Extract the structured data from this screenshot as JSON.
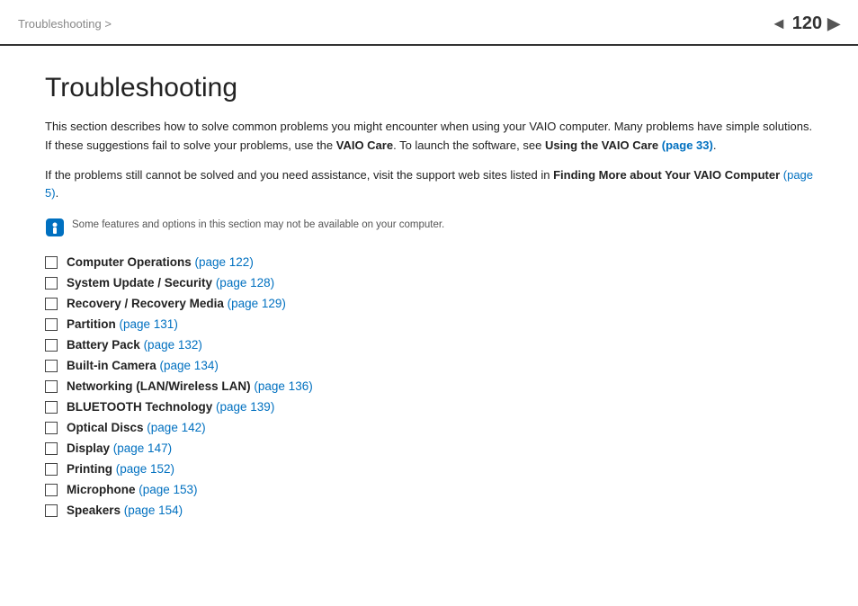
{
  "topbar": {
    "breadcrumb": "Troubleshooting >",
    "page_number": "120",
    "arrow": "◄"
  },
  "page": {
    "title": "Troubleshooting",
    "intro1": "This section describes how to solve common problems you might encounter when using your VAIO computer. Many problems have simple solutions. If these suggestions fail to solve your problems, use the ",
    "intro1_bold1": "VAIO Care",
    "intro1_mid": ". To launch the software, see ",
    "intro1_bold2": "Using the VAIO Care",
    "intro1_link1": "(page 33)",
    "intro1_end": ".",
    "intro2_start": "If the problems still cannot be solved and you need assistance, visit the support web sites listed in ",
    "intro2_bold": "Finding More about Your VAIO Computer",
    "intro2_link": "(page 5)",
    "intro2_end": ".",
    "note_text": "Some features and options in this section may not be available on your computer.",
    "topics": [
      {
        "label": "Computer Operations",
        "link": "(page 122)"
      },
      {
        "label": "System Update / Security",
        "link": "(page 128)"
      },
      {
        "label": "Recovery / Recovery Media",
        "link": "(page 129)"
      },
      {
        "label": "Partition",
        "link": "(page 131)"
      },
      {
        "label": "Battery Pack",
        "link": "(page 132)"
      },
      {
        "label": "Built-in Camera",
        "link": "(page 134)"
      },
      {
        "label": "Networking (LAN/Wireless LAN)",
        "link": "(page 136)"
      },
      {
        "label": "BLUETOOTH Technology",
        "link": "(page 139)"
      },
      {
        "label": "Optical Discs",
        "link": "(page 142)"
      },
      {
        "label": "Display",
        "link": "(page 147)"
      },
      {
        "label": "Printing",
        "link": "(page 152)"
      },
      {
        "label": "Microphone",
        "link": "(page 153)"
      },
      {
        "label": "Speakers",
        "link": "(page 154)"
      }
    ]
  }
}
